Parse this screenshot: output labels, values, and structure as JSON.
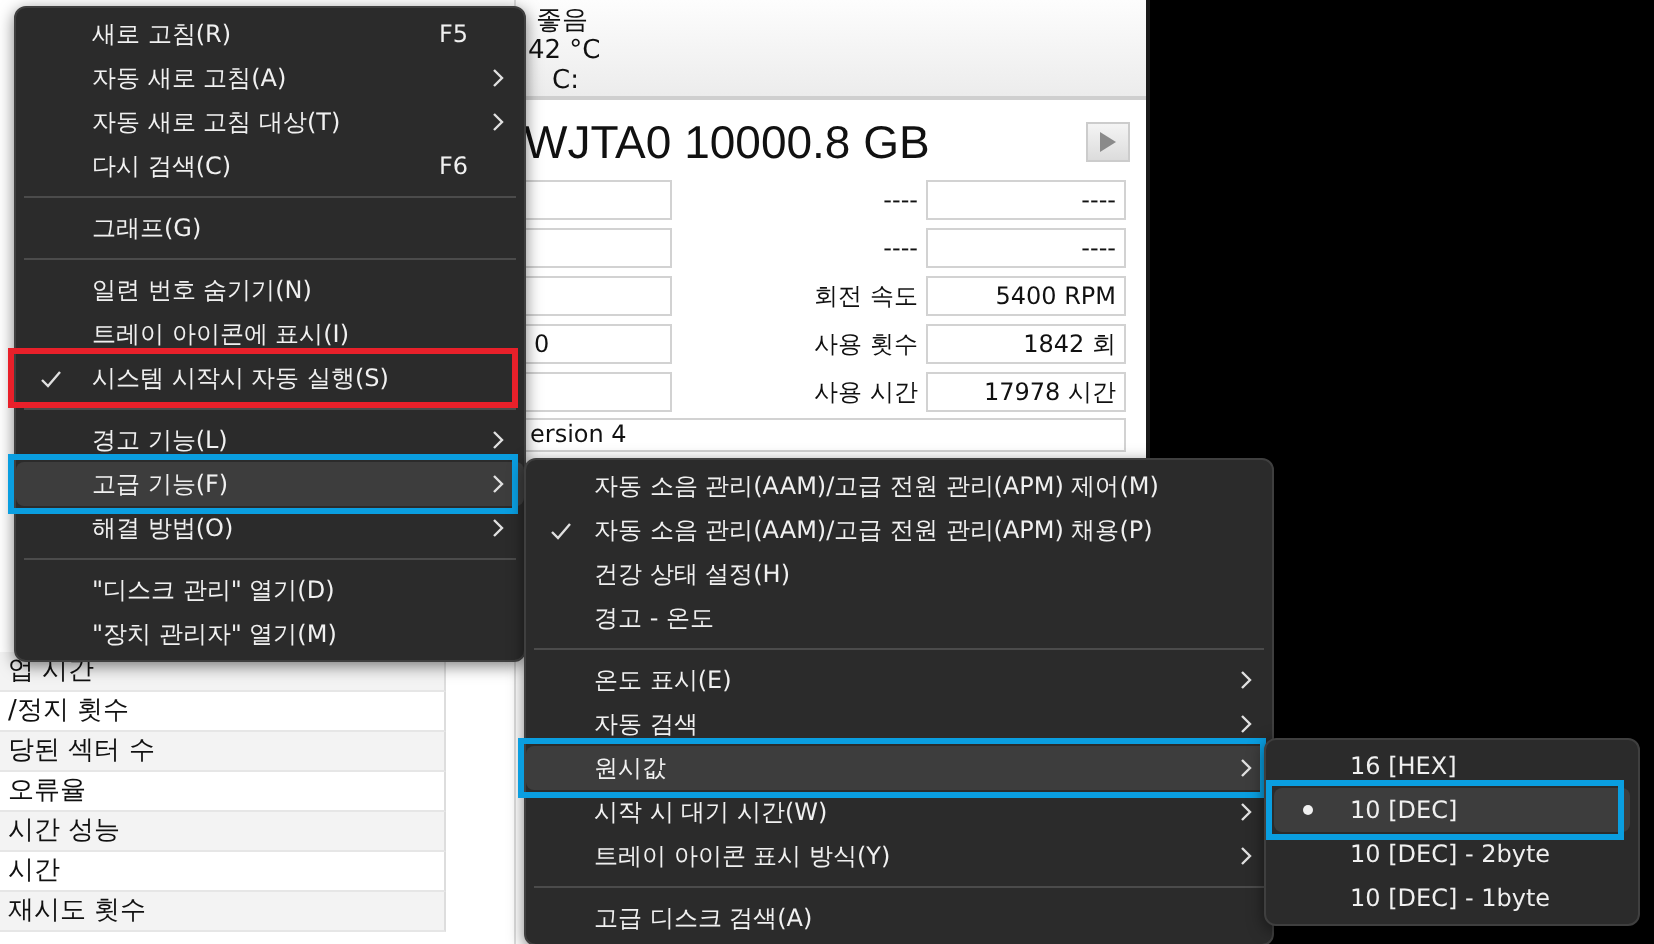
{
  "app": {
    "status": {
      "health": "좋음",
      "temperature": "42 °C",
      "drive": "C:"
    },
    "disk_title": "WJTA0 10000.8 GB",
    "fields": [
      {
        "label": "----",
        "value": "----"
      },
      {
        "label": "----",
        "value": "----"
      },
      {
        "label": "회전 속도",
        "value": "5400 RPM"
      },
      {
        "left_value": "0",
        "label": "사용 횟수",
        "value": "1842 회"
      },
      {
        "label": "사용 시간",
        "value": "17978 시간"
      }
    ],
    "standard": "ersion 4",
    "attributes": [
      "업 시간",
      "/정지 횟수",
      "당된 섹터 수",
      "오류율",
      "시간 성능",
      "시간",
      "재시도 횟수"
    ]
  },
  "context_menu": {
    "items": [
      {
        "kind": "item",
        "label": "새로 고침(R)",
        "shortcut": "F5",
        "submenu": false,
        "checked": false,
        "hovered": false
      },
      {
        "kind": "item",
        "label": "자동 새로 고침(A)",
        "submenu": true,
        "checked": false,
        "hovered": false
      },
      {
        "kind": "item",
        "label": "자동 새로 고침 대상(T)",
        "submenu": true,
        "checked": false,
        "hovered": false
      },
      {
        "kind": "item",
        "label": "다시 검색(C)",
        "shortcut": "F6",
        "submenu": false,
        "checked": false,
        "hovered": false
      },
      {
        "kind": "separator"
      },
      {
        "kind": "item",
        "label": "그래프(G)",
        "submenu": false,
        "checked": false,
        "hovered": false
      },
      {
        "kind": "separator"
      },
      {
        "kind": "item",
        "label": "일련 번호 숨기기(N)",
        "submenu": false,
        "checked": false,
        "hovered": false
      },
      {
        "kind": "item",
        "label": "트레이 아이콘에 표시(I)",
        "submenu": false,
        "checked": false,
        "hovered": false
      },
      {
        "kind": "item",
        "label": "시스템 시작시 자동 실행(S)",
        "submenu": false,
        "checked": true,
        "hovered": false,
        "color": "#e8202a"
      },
      {
        "kind": "separator"
      },
      {
        "kind": "item",
        "label": "경고 기능(L)",
        "submenu": true,
        "checked": false,
        "hovered": false
      },
      {
        "kind": "item",
        "label": "고급 기능(F)",
        "submenu": true,
        "checked": false,
        "hovered": true,
        "color": "#0a9ee0"
      },
      {
        "kind": "item",
        "label": "해결 방법(O)",
        "submenu": true,
        "checked": false,
        "hovered": false
      },
      {
        "kind": "separator"
      },
      {
        "kind": "item",
        "label": "\"디스크 관리\" 열기(D)",
        "submenu": false,
        "checked": false,
        "hovered": false
      },
      {
        "kind": "item",
        "label": "\"장치 관리자\" 열기(M)",
        "submenu": false,
        "checked": false,
        "hovered": false
      }
    ]
  },
  "advanced_submenu": {
    "items": [
      {
        "kind": "item",
        "label": "자동 소음 관리(AAM)/고급 전원 관리(APM) 제어(M)",
        "submenu": false,
        "checked": false,
        "hovered": false
      },
      {
        "kind": "item",
        "label": "자동 소음 관리(AAM)/고급 전원 관리(APM) 채용(P)",
        "submenu": false,
        "checked": true,
        "hovered": false
      },
      {
        "kind": "item",
        "label": "건강 상태 설정(H)",
        "submenu": false,
        "checked": false,
        "hovered": false
      },
      {
        "kind": "item",
        "label": "경고 - 온도",
        "submenu": false,
        "checked": false,
        "hovered": false
      },
      {
        "kind": "separator"
      },
      {
        "kind": "item",
        "label": "온도 표시(E)",
        "submenu": true,
        "checked": false,
        "hovered": false
      },
      {
        "kind": "item",
        "label": "자동 검색",
        "submenu": true,
        "checked": false,
        "hovered": false
      },
      {
        "kind": "item",
        "label": "원시값",
        "submenu": true,
        "checked": false,
        "hovered": true,
        "color": "#0a9ee0"
      },
      {
        "kind": "item",
        "label": "시작 시 대기 시간(W)",
        "submenu": true,
        "checked": false,
        "hovered": false
      },
      {
        "kind": "item",
        "label": "트레이 아이콘 표시 방식(Y)",
        "submenu": true,
        "checked": false,
        "hovered": false
      },
      {
        "kind": "separator"
      },
      {
        "kind": "item",
        "label": "고급 디스크 검색(A)",
        "submenu": false,
        "checked": false,
        "hovered": false
      }
    ]
  },
  "raw_value_submenu": {
    "items": [
      {
        "kind": "radio",
        "label": "16 [HEX]",
        "submenu": false,
        "checked": false,
        "hovered": false
      },
      {
        "kind": "radio",
        "label": "10 [DEC]",
        "submenu": false,
        "checked": true,
        "hovered": true,
        "color": "#0a9ee0"
      },
      {
        "kind": "radio",
        "label": "10 [DEC] - 2byte",
        "submenu": false,
        "checked": false,
        "hovered": false
      },
      {
        "kind": "radio",
        "label": "10 [DEC] - 1byte",
        "submenu": false,
        "checked": false,
        "hovered": false
      }
    ]
  }
}
